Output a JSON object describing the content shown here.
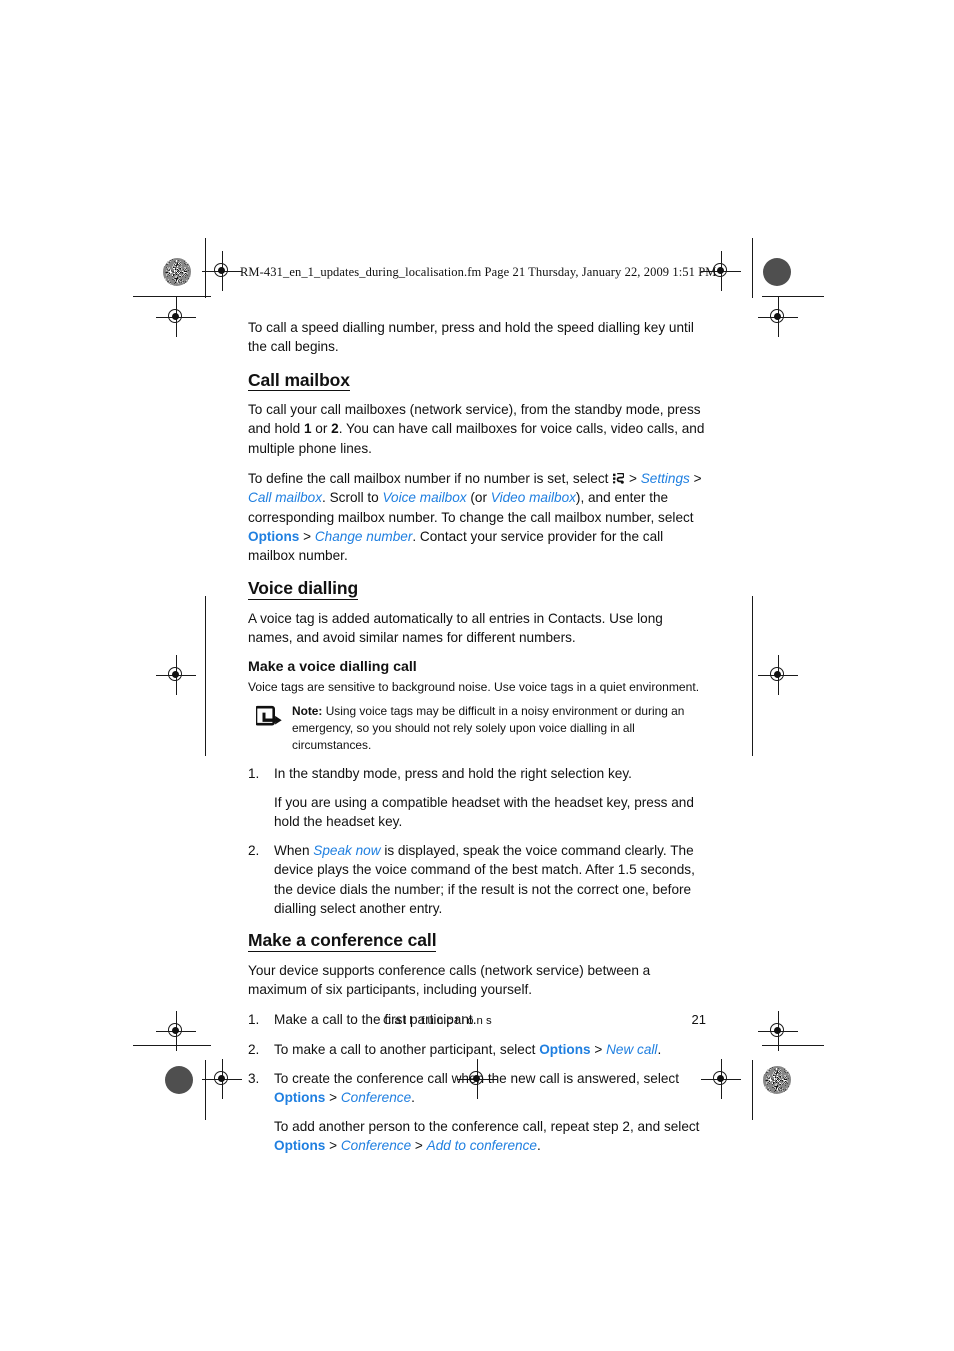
{
  "document": {
    "fileinfo": "RM-431_en_1_updates_during_localisation.fm  Page 21  Thursday, January 22, 2009  1:51 PM",
    "accent_color": "#1f7fe0",
    "text_color": "#111111"
  },
  "content": {
    "intro_paragraph": "To call a speed dialling number, press and hold the speed dialling key until the call begins.",
    "section_call_mailbox": {
      "heading": "Call mailbox",
      "para1_part1": "To call your call mailboxes (network service), from the standby mode, press and hold ",
      "para1_key1": "1",
      "para1_mid": " or ",
      "para1_key2": "2",
      "para1_part2": ". You can have call mailboxes for voice calls, video calls, and multiple phone lines.",
      "para2_part1": "To define the call mailbox number if no number is set, select ",
      "para2_icon": "menu-key-icon",
      "para2_sep1": " > ",
      "para2_link1": "Settings",
      "para2_sep2": " > ",
      "para2_link2": "Call mailbox",
      "para2_part2": ". Scroll to ",
      "para2_link3": "Voice mailbox",
      "para2_part3": " (or ",
      "para2_link4": "Video mailbox",
      "para2_part4": "), and enter the corresponding mailbox number. To change the call mailbox number, select ",
      "para2_opt": "Options",
      "para2_sep3": " > ",
      "para2_link5": "Change number",
      "para2_part5": ". Contact your service provider for the call mailbox number."
    },
    "section_voice_dialling": {
      "heading": "Voice dialling",
      "para1": "A voice tag is added automatically to all entries in Contacts. Use long names, and avoid similar names for different numbers.",
      "subheading": "Make a voice dialling call",
      "subpara": "Voice tags are sensitive to background noise. Use voice tags in a quiet environment.",
      "note": {
        "icon": "note-arrow-icon",
        "label": "Note:",
        "text": " Using voice tags may be difficult in a noisy environment or during an emergency, so you should not rely solely upon voice dialling in all circumstances."
      },
      "steps": [
        {
          "num": "1.",
          "text": "In the standby mode, press and hold the right selection key.",
          "continuation": "If you are using a compatible headset with the headset key, press and hold the headset key."
        },
        {
          "num": "2.",
          "text_part1": "When ",
          "text_link": "Speak now",
          "text_part2": " is displayed, speak the voice command clearly. The device plays the voice command of the best match. After 1.5 seconds, the device dials the number; if the result is not the correct one, before dialling select another entry."
        }
      ]
    },
    "section_conference": {
      "heading": "Make a conference call",
      "para1": "Your device supports conference calls (network service) between a maximum of six participants, including yourself.",
      "steps": [
        {
          "num": "1.",
          "text": "Make a call to the first participant."
        },
        {
          "num": "2.",
          "text_part1": "To make a call to another participant, select ",
          "opt": "Options",
          "sep": " > ",
          "link": "New call",
          "text_part2": "."
        },
        {
          "num": "3.",
          "text_part1": "To create the conference call when the new call is answered, select ",
          "opt": "Options",
          "sep": " > ",
          "link": "Conference",
          "text_part2": ".",
          "continuation_part1": "To add another person to the conference call, repeat step 2, and select ",
          "cont_opt": "Options",
          "cont_sep1": " > ",
          "cont_link1": "Conference",
          "cont_sep2": " > ",
          "cont_link2": "Add to conference",
          "continuation_part2": "."
        }
      ]
    }
  },
  "footer": {
    "chapter": "Call functions",
    "page_number": "21"
  }
}
